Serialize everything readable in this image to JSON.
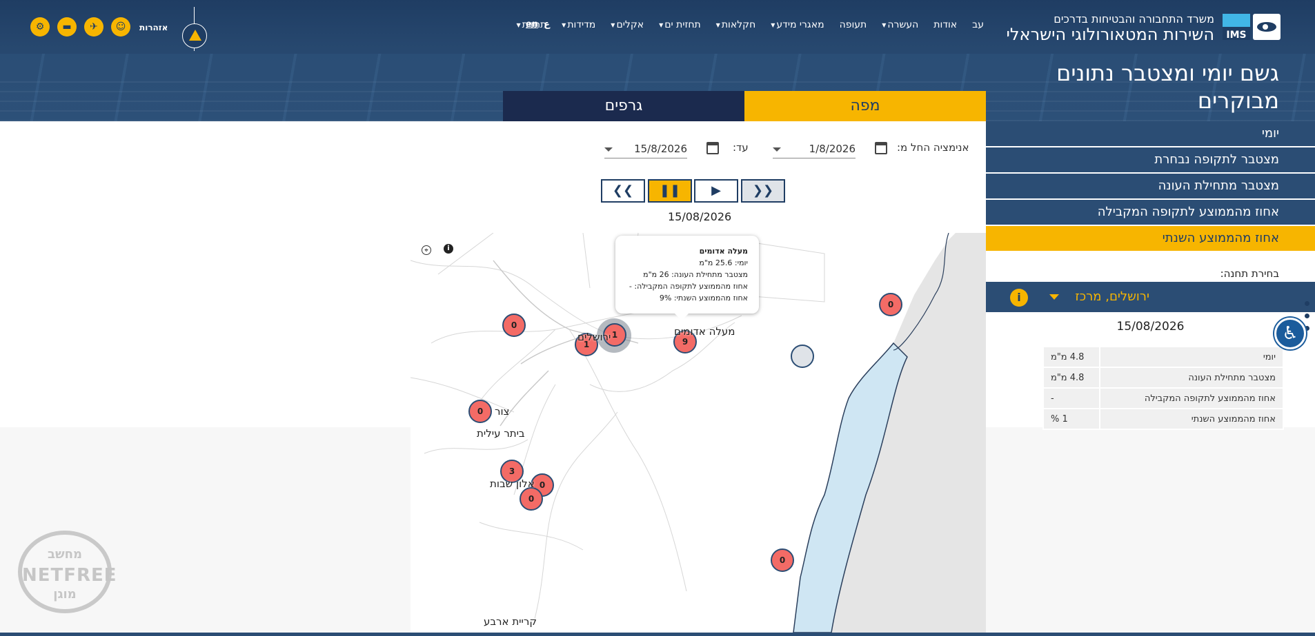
{
  "header": {
    "logo_line1": "משרד התחבורה והבטיחות בדרכים",
    "logo_line2": "השירות המטאורולוגי הישראלי",
    "logo_mark": "IMS",
    "nav": [
      {
        "label": "תחזית",
        "caret": true
      },
      {
        "label": "מדידות",
        "caret": true
      },
      {
        "label": "אקלים",
        "caret": true
      },
      {
        "label": "תחזית ים",
        "caret": true
      },
      {
        "label": "חקלאות",
        "caret": true
      },
      {
        "label": "מאגרי מידע",
        "caret": true
      },
      {
        "label": "תעופה",
        "caret": false
      },
      {
        "label": "העשרה",
        "caret": true
      },
      {
        "label": "אודות",
        "caret": false
      },
      {
        "label": "עב",
        "caret": false
      }
    ],
    "lang_en": "en",
    "lang_ar": "ع",
    "alerts_label": "אזהרות",
    "alert_icons": [
      "tractor-icon",
      "vehicle-icon",
      "airplane-icon",
      "people-icon"
    ]
  },
  "page": {
    "title": "גשם יומי ומצטבר נתונים מבוקרים"
  },
  "tabs": {
    "map": "מפה",
    "graphs": "גרפים"
  },
  "sidebar": {
    "menu": [
      {
        "label": "יומי",
        "active": false
      },
      {
        "label": "מצטבר לתקופה נבחרת",
        "active": false
      },
      {
        "label": "מצטבר מתחילת העונה",
        "active": false
      },
      {
        "label": "אחוז מהממוצע לתקופה המקבילה",
        "active": false
      },
      {
        "label": "אחוז מהממוצע השנתי",
        "active": true
      }
    ],
    "station_label": "בחירת תחנה:",
    "station_value": "ירושלים, מרכז",
    "date": "15/08/2026",
    "table": [
      {
        "k": "יומי",
        "v": "4.8 מ\"מ"
      },
      {
        "k": "מצטבר מתחילת העונה",
        "v": "4.8 מ\"מ"
      },
      {
        "k": "אחוז מהממוצע לתקופה המקבילה",
        "v": "-"
      },
      {
        "k": "אחוז מהממוצע השנתי",
        "v": "1 %"
      }
    ]
  },
  "controls": {
    "from_label": "אנימציה החל מ:",
    "from_value": "1/8/2026",
    "to_label": "עד:",
    "to_value": "15/8/2026",
    "map_date": "15/08/2026"
  },
  "map": {
    "tooltip": {
      "title": "מעלה אדומים",
      "line1": "יומי: 25.6 מ\"מ",
      "line2": "מצטבר מתחילת העונה: 26 מ\"מ",
      "line3": "אחוז מהממוצע לתקופה המקבילה: -",
      "line4": "אחוז מהממוצע השנתי: 9%"
    },
    "markers": [
      "0",
      "1",
      "1",
      "9",
      "0",
      "0",
      "3",
      "0",
      "0",
      "0"
    ],
    "cities": {
      "jerusalem": "ירושלים",
      "maale": "מעלה אדומים",
      "tzur": "צור",
      "beitar": "ביתר עילית",
      "alon": "אלון שבות",
      "arba": "קריית ארבע"
    }
  },
  "watermark": {
    "top": "מחשב",
    "mid": "NETFREE",
    "bottom": "מוגן"
  },
  "colors": {
    "navy": "#2b4d74",
    "yellow": "#f7b500",
    "marker": "#f36b66",
    "sea": "#cfe6f3"
  }
}
